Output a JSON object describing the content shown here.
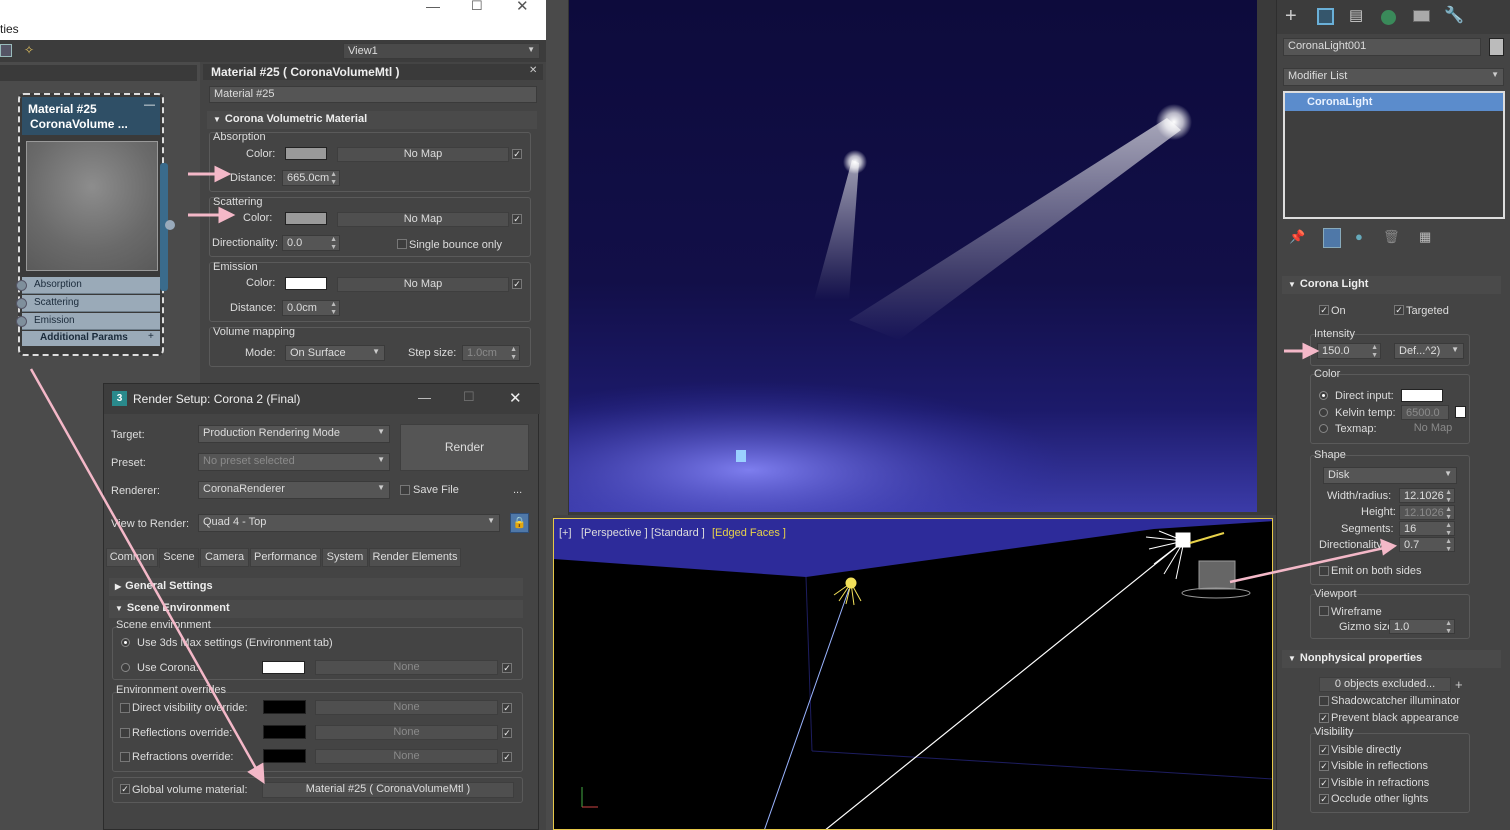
{
  "colors": {
    "panel": "#444444",
    "viewport_render": "#0c0a3a",
    "highlight": "#5b8ccc",
    "arrow": "#f4b8c8",
    "edged_faces": "#e8d24a"
  },
  "slate": {
    "window_title_fragment": "ties",
    "view_dropdown": "View1",
    "node": {
      "title_line1": "Material #25",
      "title_line2": "CoronaVolume ...",
      "slots": [
        "Absorption",
        "Scattering",
        "Emission"
      ],
      "additional": "Additional Params"
    }
  },
  "material": {
    "panel_title": "Material #25  ( CoronaVolumeMtl )",
    "name_field": "Material #25",
    "rollout_title": "Corona Volumetric Material",
    "absorption": {
      "group": "Absorption",
      "color_label": "Color:",
      "map": "No Map",
      "distance_label": "Distance:",
      "distance_value": "665.0cm"
    },
    "scattering": {
      "group": "Scattering",
      "color_label": "Color:",
      "map": "No Map",
      "directionality_label": "Directionality:",
      "directionality_value": "0.0",
      "single_bounce": "Single bounce only"
    },
    "emission": {
      "group": "Emission",
      "color_label": "Color:",
      "map": "No Map",
      "distance_label": "Distance:",
      "distance_value": "0.0cm"
    },
    "volume_mapping": {
      "group": "Volume mapping",
      "mode_label": "Mode:",
      "mode_value": "On Surface",
      "step_label": "Step size:",
      "step_value": "1.0cm"
    }
  },
  "render_setup": {
    "title": "Render Setup: Corona 2 (Final)",
    "target_label": "Target:",
    "target_value": "Production Rendering Mode",
    "preset_label": "Preset:",
    "preset_value": "No preset selected",
    "renderer_label": "Renderer:",
    "renderer_value": "CoronaRenderer",
    "save_file": "Save File",
    "view_label": "View to Render:",
    "view_value": "Quad 4 - Top",
    "render_button": "Render",
    "ellipsis": "...",
    "tabs": [
      "Common",
      "Scene",
      "Camera",
      "Performance",
      "System",
      "Render Elements"
    ],
    "general_settings": "General Settings",
    "scene_env_rollout": "Scene Environment",
    "scene_env_group": "Scene environment",
    "use_max": "Use 3ds Max settings (Environment tab)",
    "use_corona": "Use Corona:",
    "none": "None",
    "env_overrides_group": "Environment overrides",
    "direct_vis": "Direct visibility override:",
    "reflections": "Reflections override:",
    "refractions": "Refractions override:",
    "global_volume_label": "Global volume material:",
    "global_volume_value": "Material #25  ( CoronaVolumeMtl )"
  },
  "viewport": {
    "label_plus": "[+]",
    "label_persp": "[Perspective ]",
    "label_std": "[Standard ]",
    "label_edged": "[Edged Faces ]"
  },
  "cmd_panel": {
    "object_name": "CoronaLight001",
    "modifier_list": "Modifier List",
    "stack_item": "CoronaLight",
    "rollout_light": "Corona Light",
    "on": "On",
    "targeted": "Targeted",
    "intensity_group": "Intensity",
    "intensity_value": "150.0",
    "intensity_unit": "Def...^2)",
    "color_group": "Color",
    "direct_input": "Direct input:",
    "kelvin_temp": "Kelvin temp:",
    "kelvin_value": "6500.0",
    "texmap": "Texmap:",
    "texmap_value": "No Map",
    "shape_group": "Shape",
    "shape_value": "Disk",
    "width_label": "Width/radius:",
    "width_value": "12.1026",
    "height_label": "Height:",
    "height_value": "12.1026",
    "segments_label": "Segments:",
    "segments_value": "16",
    "directionality_label": "Directionality:",
    "directionality_value": "0.7",
    "emit_both": "Emit on both sides",
    "viewport_group": "Viewport",
    "wireframe": "Wireframe",
    "gizmo_label": "Gizmo size:",
    "gizmo_value": "1.0",
    "rollout_nonphys": "Nonphysical properties",
    "excluded": "0 objects excluded...",
    "shadowcatcher": "Shadowcatcher illuminator",
    "prevent_black": "Prevent black appearance",
    "visibility_group": "Visibility",
    "vis_directly": "Visible directly",
    "vis_reflections": "Visible in reflections",
    "vis_refractions": "Visible in refractions",
    "occlude": "Occlude other lights"
  }
}
